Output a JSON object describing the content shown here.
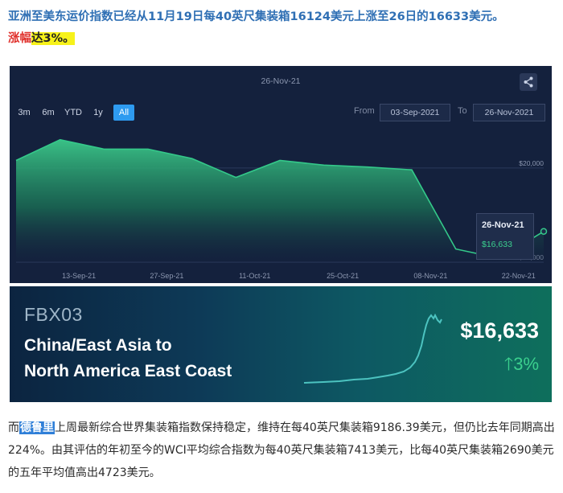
{
  "headline": {
    "line1": "亚洲至美东运价指数已经从11月19日每40英尺集装箱16124美元上涨至26日的16633美元。",
    "rise_label": "涨幅",
    "rise_value": "达3%。"
  },
  "chart": {
    "top_date": "26-Nov-21",
    "range_buttons": [
      "3m",
      "6m",
      "YTD",
      "1y",
      "All"
    ],
    "active_range": "All",
    "from_label": "From",
    "from_value": "03-Sep-2021",
    "to_label": "To",
    "to_value": "26-Nov-2021",
    "tooltip_date": "26-Nov-21",
    "tooltip_value": "$16,633",
    "colors": {
      "background": "#14213d",
      "line": "#34c98a",
      "tooltip_value": "#3bd08e"
    }
  },
  "chart_data": {
    "type": "area",
    "x": [
      "03-Sep-21",
      "10-Sep-21",
      "17-Sep-21",
      "24-Sep-21",
      "01-Oct-21",
      "08-Oct-21",
      "15-Oct-21",
      "22-Oct-21",
      "29-Oct-21",
      "05-Nov-21",
      "12-Nov-21",
      "19-Nov-21",
      "26-Nov-21"
    ],
    "values": [
      20400,
      21500,
      21000,
      21000,
      20500,
      19500,
      20400,
      20150,
      20050,
      19900,
      15700,
      15200,
      16633
    ],
    "x_ticks": [
      "13-Sep-21",
      "27-Sep-21",
      "11-Oct-21",
      "25-Oct-21",
      "08-Nov-21",
      "22-Nov-21"
    ],
    "y_ticks": [
      "$15,000",
      "$20,000"
    ],
    "ylim": [
      15000,
      22000
    ],
    "grid": true
  },
  "banner": {
    "code": "FBX03",
    "route_line1": "China/East Asia to",
    "route_line2": "North America East Coast",
    "price": "$16,633",
    "change_arrow": "arrow-up-icon",
    "change": "3%"
  },
  "body": {
    "prefix": "而",
    "name": "德鲁里",
    "text": "上周最新综合世界集装箱指数保持稳定，维持在每40英尺集装箱9186.39美元，但仍比去年同期高出224%。由其评估的年初至今的WCI平均综合指数为每40英尺集装箱7413美元，比每40英尺集装箱2690美元的五年平均值高出4723美元。"
  }
}
